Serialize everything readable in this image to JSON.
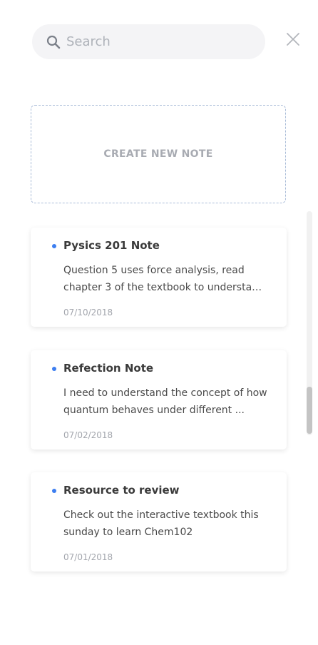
{
  "search": {
    "placeholder": "Search",
    "value": ""
  },
  "create_note": {
    "label": "CREATE NEW NOTE"
  },
  "colors": {
    "accent_dot": "#3d7ef0",
    "dashed_border": "#a9bcd8",
    "muted_text": "#a8abb2"
  },
  "notes": [
    {
      "title": "Pysics 201 Note",
      "body": "Question 5 uses force analysis, read chapter 3 of the textbook to understa…",
      "date": "07/10/2018"
    },
    {
      "title": "Refection Note",
      "body": "I need to understand the concept of how quantum behaves under different ...",
      "date": "07/02/2018"
    },
    {
      "title": "Resource to review",
      "body": "Check out the interactive textbook this sunday to learn Chem102",
      "date": "07/01/2018"
    }
  ]
}
